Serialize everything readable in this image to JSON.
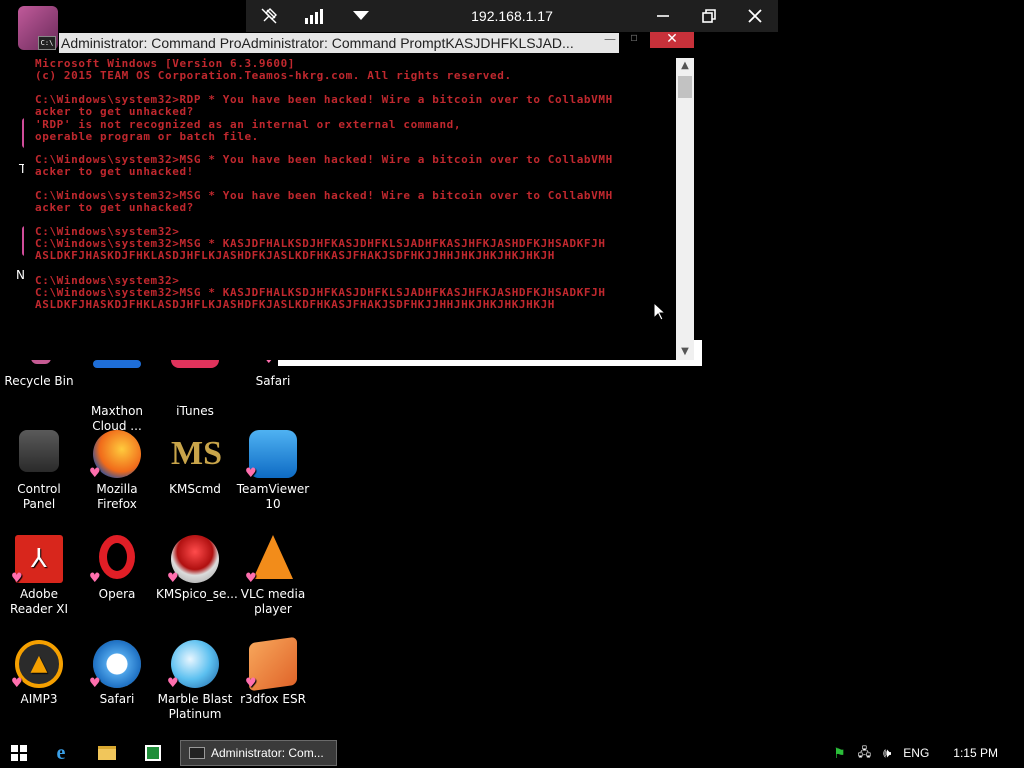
{
  "rdp_bar": {
    "ip": "192.168.1.17",
    "icons": [
      "pin-off-icon",
      "signal-bars-icon",
      "dropdown-icon",
      "minimize-icon",
      "restore-icon",
      "close-icon"
    ]
  },
  "cmd": {
    "title": "Administrator: Command ProAdministrator: Command PromptKASJDHFKLSJAD...",
    "lines": [
      "Microsoft Windows [Version 6.3.9600]",
      "(c) 2015 TEAM OS Corporation.Teamos-hkrg.com. All rights reserved.",
      "",
      "C:\\Windows\\system32>RDP * You have been hacked! Wire a bitcoin over to CollabVMH",
      "acker to get unhacked?",
      "'RDP' is not recognized as an internal or external command,",
      "operable program or batch file.",
      "",
      "C:\\Windows\\system32>MSG * You have been hacked! Wire a bitcoin over to CollabVMH",
      "acker to get unhacked!",
      "",
      "C:\\Windows\\system32>MSG * You have been hacked! Wire a bitcoin over to CollabVMH",
      "acker to get unhacked?",
      "",
      "C:\\Windows\\system32>",
      "C:\\Windows\\system32>MSG * KASJDFHALKSDJHFKASJDHFKLSJADHFKASJHFKJASHDFKJHSADKFJH",
      "ASLDKFJHASKDJFHKLASDJHFLKJASHDFKJASLKDFHKASJFHAKJSDFHKJJHHJHKJHKJHKJHKJH",
      "",
      "C:\\Windows\\system32>",
      "C:\\Windows\\system32>MSG * KASJDFHALKSDJHFKASJDHFKLSJADHFKASJHFKJASHDFKJHSADKFJH",
      "ASLDKFJHASKDJFHKLASDJHFLKJASHDFKJASLKDFHKASJFHAKJSDFHKJJHHJHKJHKJHKJHKJH"
    ]
  },
  "desktop": {
    "top_partial": [
      {
        "label": "",
        "name": "folder-partial-icon"
      },
      {
        "label": "Thi",
        "name": "this-pc-partial-icon"
      },
      {
        "label": "Net",
        "name": "network-partial-icon"
      }
    ],
    "icons": [
      {
        "label": "Recycle Bin",
        "name": "recycle-bin-icon"
      },
      {
        "label": "Maxthon Cloud ...",
        "name": "maxthon-icon"
      },
      {
        "label": "iTunes",
        "name": "itunes-icon"
      },
      {
        "label": "Safari",
        "name": "safari-icon"
      },
      {
        "label": "Control Panel",
        "name": "control-panel-icon"
      },
      {
        "label": "Mozilla Firefox",
        "name": "firefox-icon"
      },
      {
        "label": "KMScmd",
        "name": "kmscmd-icon"
      },
      {
        "label": "TeamViewer 10",
        "name": "teamviewer-icon"
      },
      {
        "label": "Adobe Reader XI",
        "name": "adobe-reader-icon"
      },
      {
        "label": "Opera",
        "name": "opera-icon"
      },
      {
        "label": "KMSpico_se...",
        "name": "kmspico-icon"
      },
      {
        "label": "VLC media player",
        "name": "vlc-icon"
      },
      {
        "label": "AIMP3",
        "name": "aimp3-icon"
      },
      {
        "label": "Safari",
        "name": "safari-icon"
      },
      {
        "label": "Marble Blast Platinum",
        "name": "marble-blast-icon"
      },
      {
        "label": "r3dfox ESR",
        "name": "r3dfox-icon"
      }
    ]
  },
  "taskbar": {
    "task_label": "Administrator: Com...",
    "language": "ENG",
    "time": "1:15 PM"
  },
  "colors": {
    "console_text": "#c0282e",
    "close_button": "#c7313a"
  }
}
